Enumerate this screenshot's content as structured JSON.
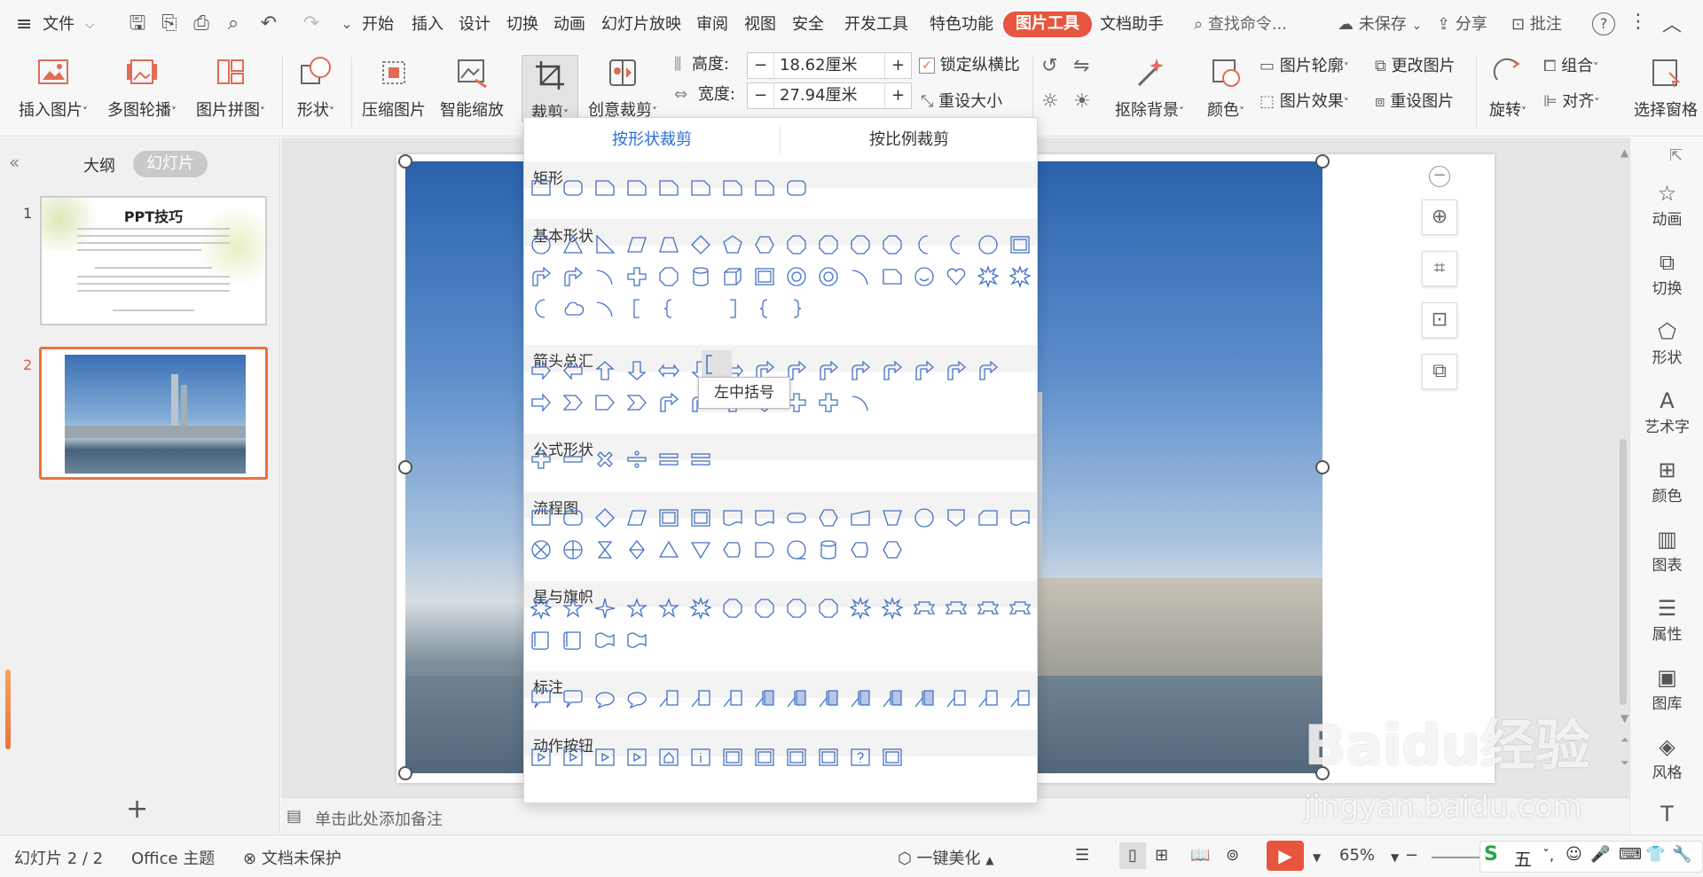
{
  "menubar": {
    "file_label": "文件",
    "items": [
      "开始",
      "插入",
      "设计",
      "切换",
      "动画",
      "幻灯片放映",
      "审阅",
      "视图",
      "安全",
      "开发工具",
      "特色功能",
      "图片工具",
      "文档助手"
    ],
    "search_placeholder": "查找命令...",
    "unsaved_label": "未保存",
    "share_label": "分享",
    "comment_label": "批注"
  },
  "ribbon": {
    "insert_picture": "插入图片",
    "multi_carousel": "多图轮播",
    "picture_collage": "图片拼图",
    "shape": "形状",
    "compress": "压缩图片",
    "smart_scale": "智能缩放",
    "crop": "裁剪",
    "creative_crop": "创意裁剪",
    "height_label": "高度:",
    "height_value": "18.62厘米",
    "width_label": "宽度:",
    "width_value": "27.94厘米",
    "lock_ratio": "锁定纵横比",
    "reset_size": "重设大小",
    "remove_bg": "抠除背景",
    "color": "颜色",
    "outline": "图片轮廓",
    "effects": "图片效果",
    "change_picture": "更改图片",
    "reset_picture": "重设图片",
    "rotate": "旋转",
    "group": "组合",
    "align": "对齐",
    "select_pane": "选择窗格"
  },
  "leftpanel": {
    "outline_tab": "大纲",
    "slides_tab": "幻灯片",
    "slide1_num": "1",
    "slide1_title": "PPT技巧",
    "slide2_num": "2"
  },
  "dropdown": {
    "tab_shape_crop": "按形状裁剪",
    "tab_ratio_crop": "按比例裁剪",
    "categories": [
      "矩形",
      "基本形状",
      "箭头总汇",
      "公式形状",
      "流程图",
      "星与旗帜",
      "标注",
      "动作按钮"
    ],
    "tooltip": "左中括号"
  },
  "notes_placeholder": "单击此处添加备注",
  "rightpanel": [
    "动画",
    "切换",
    "形状",
    "艺术字",
    "颜色",
    "图表",
    "属性",
    "图库",
    "风格"
  ],
  "statusbar": {
    "slide_count": "幻灯片 2 / 2",
    "theme": "Office 主题",
    "protect": "文档未保护",
    "beautify": "一键美化",
    "zoom": "65%"
  },
  "watermark": {
    "brand": "Baidu经验",
    "url": "jingyan.baidu.com"
  },
  "colors": {
    "accent": "#e8553e",
    "shape_blue": "#4472c4",
    "tab_blue": "#2b6fd6"
  }
}
